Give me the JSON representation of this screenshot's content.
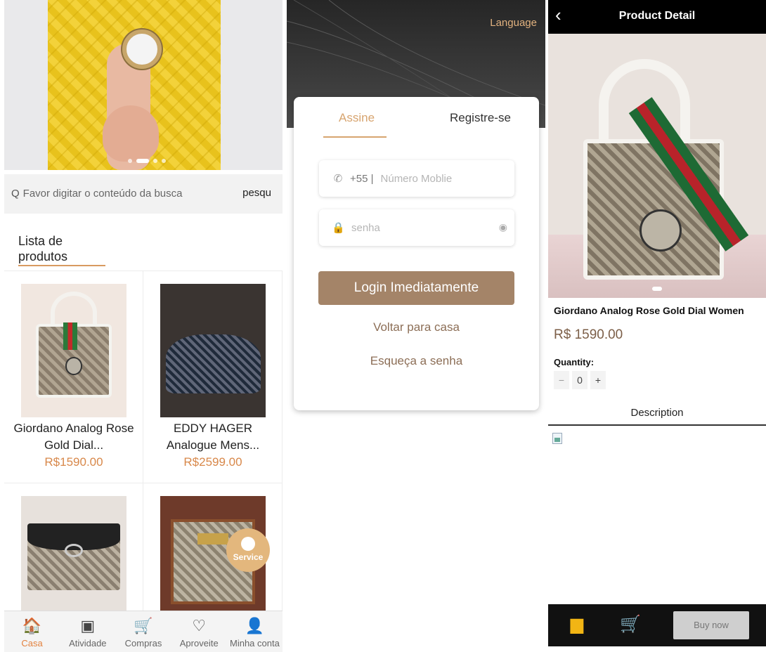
{
  "home": {
    "search": {
      "placeholder": "Favor digitar o conteúdo da busca",
      "button": "pesqu"
    },
    "list_title": "Lista de produtos",
    "products": [
      {
        "name": "Giordano Analog Rose Gold Dial...",
        "price": "R$1590.00"
      },
      {
        "name": "EDDY HAGER Analogue Mens...",
        "price": "R$2599.00"
      }
    ],
    "service_label": "Service",
    "tabbar": [
      {
        "label": "Casa",
        "icon": "home-icon",
        "glyph": "🏠"
      },
      {
        "label": "Atividade",
        "icon": "activity-icon",
        "glyph": "▣"
      },
      {
        "label": "Compras",
        "icon": "cart-icon",
        "glyph": "🛒"
      },
      {
        "label": "Aproveite",
        "icon": "balloons-icon",
        "glyph": "♡"
      },
      {
        "label": "Minha conta",
        "icon": "user-icon",
        "glyph": "👤"
      }
    ]
  },
  "login": {
    "language": "Language",
    "tabs": {
      "sign_in": "Assine",
      "register": "Registre-se"
    },
    "phone": {
      "prefix": "+55 |",
      "placeholder": "Número Moblie"
    },
    "password": {
      "placeholder": "senha"
    },
    "login_button": "Login Imediatamente",
    "back_home": "Voltar para casa",
    "forgot": "Esqueça a senha"
  },
  "detail": {
    "title": "Product Detail",
    "back_glyph": "‹",
    "name": "Giordano Analog Rose Gold Dial Women",
    "price": "R$ 1590.00",
    "quantity_label": "Quantity:",
    "quantity": {
      "minus": "−",
      "value": "0",
      "plus": "+"
    },
    "description_label": "Description",
    "buy_button": "Buy now"
  },
  "colors": {
    "accent": "#d8884a",
    "login_button": "#a48468",
    "tab_active": "#e3823f",
    "bottom_icons": "#f2b514"
  }
}
